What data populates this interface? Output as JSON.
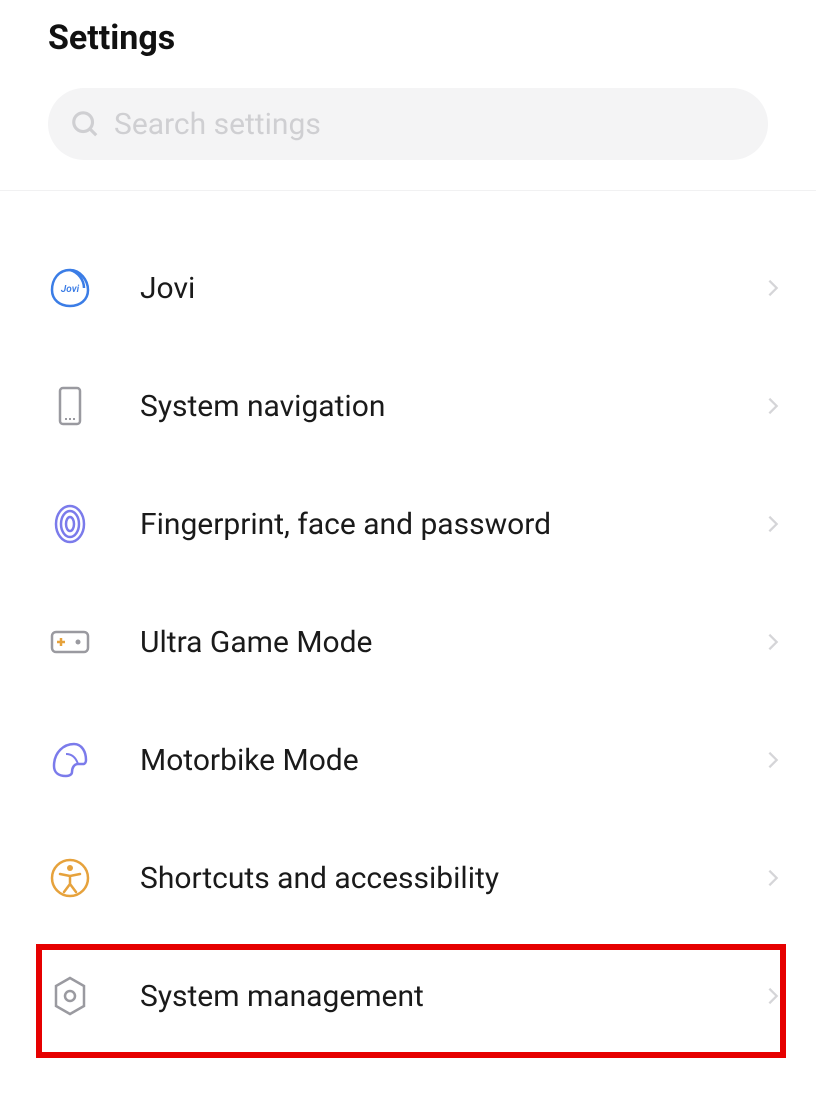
{
  "header": {
    "title": "Settings"
  },
  "search": {
    "placeholder": "Search settings"
  },
  "items": [
    {
      "label": "Jovi",
      "icon": "jovi"
    },
    {
      "label": "System navigation",
      "icon": "system-navigation"
    },
    {
      "label": "Fingerprint, face and password",
      "icon": "fingerprint"
    },
    {
      "label": "Ultra Game Mode",
      "icon": "game"
    },
    {
      "label": "Motorbike Mode",
      "icon": "helmet"
    },
    {
      "label": "Shortcuts and accessibility",
      "icon": "accessibility"
    },
    {
      "label": "System management",
      "icon": "system-management"
    }
  ]
}
